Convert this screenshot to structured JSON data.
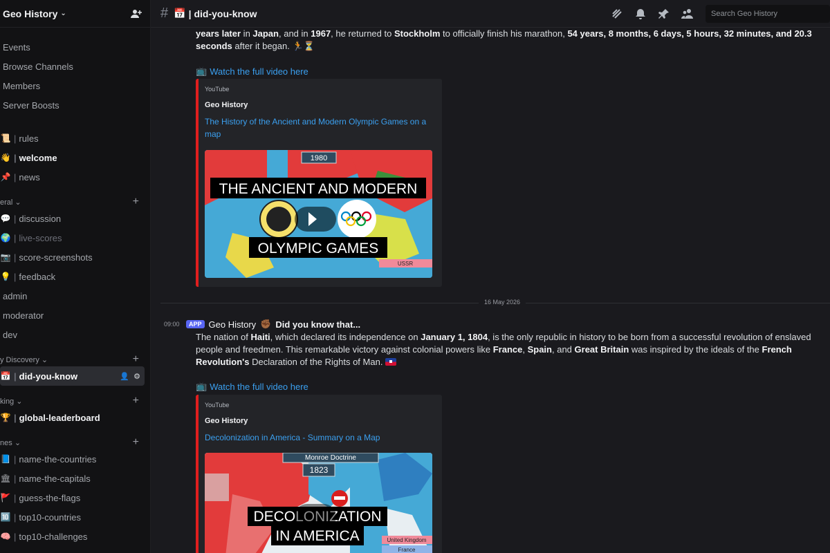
{
  "server": {
    "name": "Geo History"
  },
  "sidebar": {
    "top_links": [
      "Events",
      "Browse Channels",
      "Members",
      "Server Boosts"
    ],
    "pinned_channels": [
      {
        "emoji": "📜",
        "name": "rules"
      },
      {
        "emoji": "👋",
        "name": "welcome"
      },
      {
        "emoji": "📌",
        "name": "news"
      }
    ],
    "categories": [
      {
        "label": "eral",
        "channels": [
          {
            "emoji": "💬",
            "name": "discussion"
          },
          {
            "emoji": "🌍",
            "name": "live-scores"
          },
          {
            "emoji": "📷",
            "name": "score-screenshots"
          },
          {
            "emoji": "💡",
            "name": "feedback"
          },
          {
            "emoji": "",
            "name": "admin"
          },
          {
            "emoji": "",
            "name": "moderator"
          },
          {
            "emoji": "",
            "name": "dev"
          }
        ]
      },
      {
        "label": "y Discovery",
        "channels": [
          {
            "emoji": "📅",
            "name": "did-you-know"
          }
        ]
      },
      {
        "label": "king",
        "channels": [
          {
            "emoji": "🏆",
            "name": "global-leaderboard"
          }
        ]
      },
      {
        "label": "nes",
        "channels": [
          {
            "emoji": "📘",
            "name": "name-the-countries"
          },
          {
            "emoji": "🏛",
            "name": "name-the-capitals"
          },
          {
            "emoji": "🚩",
            "name": "guess-the-flags"
          },
          {
            "emoji": "🔟",
            "name": "top10-countries"
          },
          {
            "emoji": "🧠",
            "name": "top10-challenges"
          }
        ]
      }
    ]
  },
  "topbar": {
    "channel_emoji": "📅",
    "channel_name": "did-you-know",
    "search_placeholder": "Search Geo History"
  },
  "messages": {
    "first": {
      "link_label": "Watch the full video here",
      "embed": {
        "provider": "YouTube",
        "author": "Geo History",
        "title": "The History of the Ancient and Modern Olympic Games on a map",
        "thumb_year": "1980",
        "thumb_line1": "THE ANCIENT AND MODERN",
        "thumb_line2": "OLYMPIC GAMES",
        "thumb_tag": "USSR"
      }
    },
    "date_divider": "16 May 2026",
    "second": {
      "time": "09:00",
      "badge": "APP",
      "author": "Geo History",
      "title_emoji": "✊🏾",
      "headline": "Did you know that...",
      "link_label": "Watch the full video here",
      "embed": {
        "provider": "YouTube",
        "author": "Geo History",
        "title": "Decolonization in America - Summary on a Map",
        "thumb_banner": "Monroe Doctrine",
        "thumb_year": "1823",
        "thumb_line1": "DECOLONIZATION",
        "thumb_line2": "IN AMERICA",
        "thumb_tag1": "United Kingdom",
        "thumb_tag2": "France"
      }
    }
  },
  "colors": {
    "accent": "#5865f2",
    "link": "#3ba0f0",
    "embed_border": "#e01e1e"
  }
}
